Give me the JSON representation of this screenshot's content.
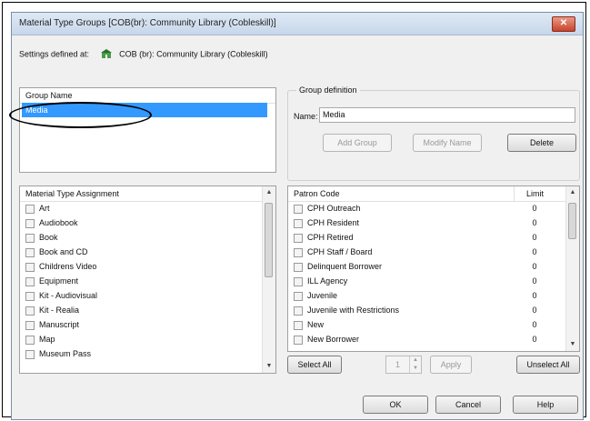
{
  "window": {
    "title": "Material Type Groups [COB(br): Community Library (Cobleskill)]",
    "close_label": "✕"
  },
  "settings": {
    "label": "Settings defined at:",
    "value": "COB (br): Community Library (Cobleskill)"
  },
  "group_list": {
    "header": "Group Name",
    "items": [
      {
        "label": "Media",
        "selected": true
      }
    ]
  },
  "group_definition": {
    "legend": "Group definition",
    "name_label": "Name:",
    "name_value": "Media",
    "add_label": "Add Group",
    "modify_label": "Modify Name",
    "delete_label": "Delete"
  },
  "material_types": {
    "header": "Material Type Assignment",
    "items": [
      "Art",
      "Audiobook",
      "Book",
      "Book and CD",
      "Childrens Video",
      "Equipment",
      "Kit - Audiovisual",
      "Kit - Realia",
      "Manuscript",
      "Map",
      "Museum Pass"
    ]
  },
  "patron_codes": {
    "header_code": "Patron Code",
    "header_limit": "Limit",
    "rows": [
      {
        "code": "CPH Outreach",
        "limit": "0"
      },
      {
        "code": "CPH Resident",
        "limit": "0"
      },
      {
        "code": "CPH Retired",
        "limit": "0"
      },
      {
        "code": "CPH Staff / Board",
        "limit": "0"
      },
      {
        "code": "Delinquent Borrower",
        "limit": "0"
      },
      {
        "code": "ILL Agency",
        "limit": "0"
      },
      {
        "code": "Juvenile",
        "limit": "0"
      },
      {
        "code": "Juvenile with Restrictions",
        "limit": "0"
      },
      {
        "code": "New",
        "limit": "0"
      },
      {
        "code": "New Borrower",
        "limit": "0"
      }
    ]
  },
  "bottom_controls": {
    "select_all_label": "Select All",
    "spin_value": "1",
    "apply_label": "Apply",
    "unselect_all_label": "Unselect All"
  },
  "footer": {
    "ok_label": "OK",
    "cancel_label": "Cancel",
    "help_label": "Help"
  },
  "colors": {
    "selection": "#3399ff",
    "dialog_bg": "#f0f0f0",
    "close_button": "#c8432b"
  }
}
